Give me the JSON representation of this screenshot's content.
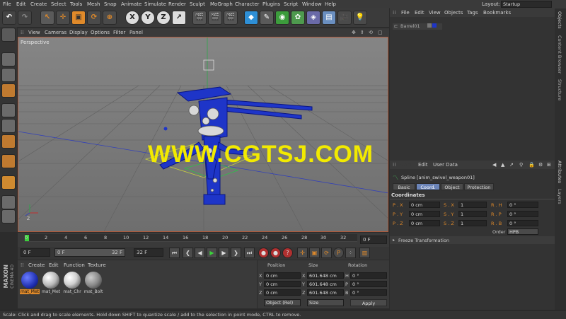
{
  "menubar": {
    "items": [
      "File",
      "Edit",
      "Create",
      "Select",
      "Tools",
      "Mesh",
      "Snap",
      "Animate",
      "Simulate",
      "Render",
      "Sculpt",
      "MoGraph",
      "Character",
      "Plugins",
      "Script",
      "Window",
      "Help"
    ],
    "layout_label": "Layout:",
    "layout_value": "Startup"
  },
  "viewport": {
    "menu": [
      "View",
      "Cameras",
      "Display",
      "Options",
      "Filter",
      "Panel"
    ],
    "label": "Perspective",
    "watermark": "WWW.CGTSJ.COM"
  },
  "timeline": {
    "ticks": [
      "0",
      "2",
      "4",
      "6",
      "8",
      "10",
      "12",
      "14",
      "16",
      "18",
      "20",
      "22",
      "24",
      "26",
      "28",
      "30",
      "32"
    ],
    "frame_field": "0 F"
  },
  "playbar": {
    "start": "0 F",
    "range_start": "0 F",
    "range_end": "32 F",
    "end": "32 F"
  },
  "materials": {
    "menu": [
      "Create",
      "Edit",
      "Function",
      "Texture"
    ],
    "items": [
      {
        "name": "mat_Met",
        "color": "#1f2fb0"
      },
      {
        "name": "mat_Met",
        "color": "#b8b8b8"
      },
      {
        "name": "mat_Chr",
        "color": "#d0d0d0"
      },
      {
        "name": "mat_Bolt",
        "color": "#8a8a8a"
      }
    ],
    "brand1": "MAXON",
    "brand2": "CINEMA 4D"
  },
  "coords": {
    "headers": [
      "Position",
      "Size",
      "Rotation"
    ],
    "rows": [
      {
        "axis": "X",
        "pos": "0 cm",
        "size_axis": "X",
        "size": "601.648 cm",
        "rot_axis": "H",
        "rot": "0 °"
      },
      {
        "axis": "Y",
        "pos": "0 cm",
        "size_axis": "Y",
        "size": "601.648 cm",
        "rot_axis": "P",
        "rot": "0 °"
      },
      {
        "axis": "Z",
        "pos": "0 cm",
        "size_axis": "Z",
        "size": "601.648 cm",
        "rot_axis": "B",
        "rot": "0 °"
      }
    ],
    "mode": "Object (Rel)",
    "size_mode": "Size",
    "apply": "Apply"
  },
  "objects": {
    "menu": [
      "File",
      "Edit",
      "View",
      "Objects",
      "Tags",
      "Bookmarks"
    ],
    "item": "Barrel01"
  },
  "attributes": {
    "menu": [
      "Mode",
      "Edit",
      "User Data"
    ],
    "object_title": "Spline [anim_swivel_weapon01]",
    "tabs": [
      "Basic",
      "Coord.",
      "Object",
      "Protection"
    ],
    "active_tab": "Coord.",
    "section": "Coordinates",
    "rows": [
      {
        "p_label": "P . X",
        "p_val": "0 cm",
        "s_label": "S . X",
        "s_val": "1",
        "r_label": "R . H",
        "r_val": "0 °"
      },
      {
        "p_label": "P . Y",
        "p_val": "0 cm",
        "s_label": "S . Y",
        "s_val": "1",
        "r_label": "R . P",
        "r_val": "0 °"
      },
      {
        "p_label": "P . Z",
        "p_val": "0 cm",
        "s_label": "S . Z",
        "s_val": "1",
        "r_label": "R . B",
        "r_val": "0 °"
      }
    ],
    "order_label": "Order",
    "order_value": "HPB",
    "freeze": "Freeze Transformation"
  },
  "side_tabs": [
    "Objects",
    "Content Browser",
    "Structure",
    "Attributes",
    "Layers"
  ],
  "status": "Scale: Click and drag to scale elements. Hold down SHIFT to quantize scale / add to the selection in point mode, CTRL to remove.",
  "colors": {
    "accent_orange": "#e08a2a",
    "weapon_blue": "#1e35c8",
    "watermark_yellow": "#f2ea00",
    "viewport_bg": "#7c7c7c"
  }
}
